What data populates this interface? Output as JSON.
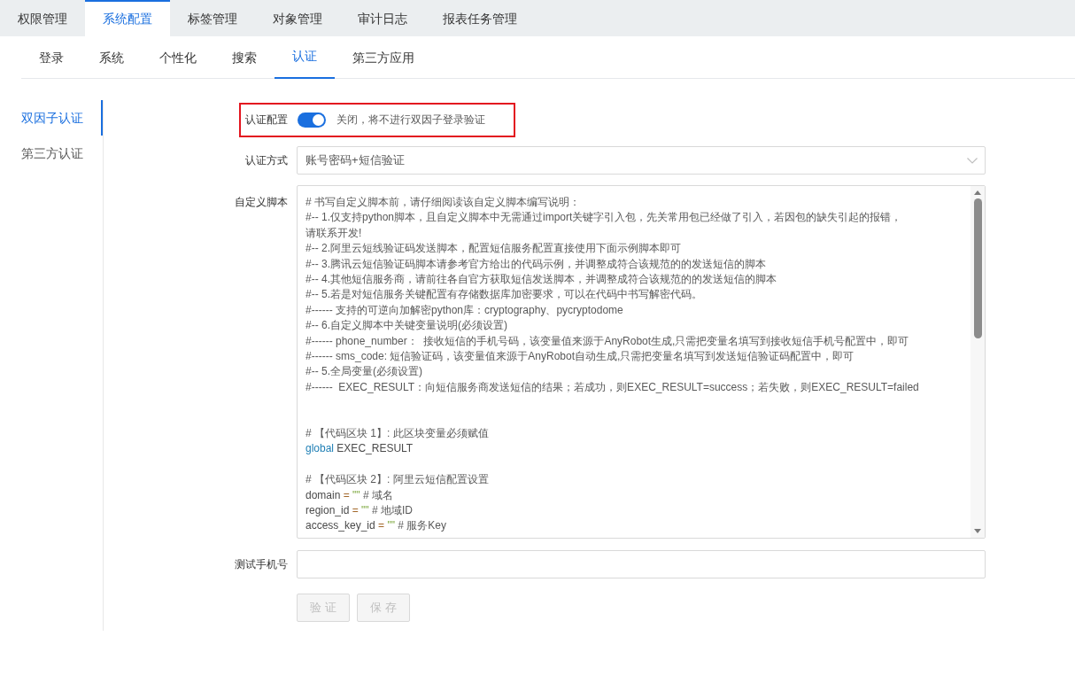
{
  "top_tabs": [
    {
      "label": "权限管理",
      "selected": false
    },
    {
      "label": "系统配置",
      "selected": true
    },
    {
      "label": "标签管理",
      "selected": false
    },
    {
      "label": "对象管理",
      "selected": false
    },
    {
      "label": "审计日志",
      "selected": false
    },
    {
      "label": "报表任务管理",
      "selected": false
    }
  ],
  "sub_tabs": [
    {
      "label": "登录",
      "selected": false
    },
    {
      "label": "系统",
      "selected": false
    },
    {
      "label": "个性化",
      "selected": false
    },
    {
      "label": "搜索",
      "selected": false
    },
    {
      "label": "认证",
      "selected": true
    },
    {
      "label": "第三方应用",
      "selected": false
    }
  ],
  "sidebar": {
    "items": [
      {
        "label": "双因子认证",
        "selected": true
      },
      {
        "label": "第三方认证",
        "selected": false
      }
    ]
  },
  "form": {
    "auth_config": {
      "label": "认证配置",
      "on": true,
      "description": "关闭，将不进行双因子登录验证",
      "highlighted": true
    },
    "auth_method": {
      "label": "认证方式",
      "value": "账号密码+短信验证"
    },
    "custom_script": {
      "label": "自定义脚本",
      "lines": [
        {
          "kind": "comment",
          "text": "# 书写自定义脚本前，请仔细阅读该自定义脚本编写说明："
        },
        {
          "kind": "comment",
          "text": "#-- 1.仅支持python脚本，且自定义脚本中无需通过import关键字引入包，先关常用包已经做了引入，若因包的缺失引起的报错，"
        },
        {
          "kind": "comment",
          "text": "请联系开发!"
        },
        {
          "kind": "comment",
          "text": "#-- 2.阿里云短线验证码发送脚本，配置短信服务配置直接使用下面示例脚本即可"
        },
        {
          "kind": "comment",
          "text": "#-- 3.腾讯云短信验证码脚本请参考官方给出的代码示例，并调整成符合该规范的的发送短信的脚本"
        },
        {
          "kind": "comment",
          "text": "#-- 4.其他短信服务商，请前往各自官方获取短信发送脚本，并调整成符合该规范的的发送短信的脚本"
        },
        {
          "kind": "comment",
          "text": "#-- 5.若是对短信服务关键配置有存储数据库加密要求，可以在代码中书写解密代码。"
        },
        {
          "kind": "comment",
          "text": "#------ 支持的可逆向加解密python库：cryptography、pycryptodome"
        },
        {
          "kind": "comment",
          "text": "#-- 6.自定义脚本中关键变量说明(必须设置)"
        },
        {
          "kind": "comment",
          "text": "#------ phone_number：  接收短信的手机号码，该变量值来源于AnyRobot生成,只需把变量名填写到接收短信手机号配置中，即可"
        },
        {
          "kind": "comment",
          "text": "#------ sms_code: 短信验证码，该变量值来源于AnyRobot自动生成,只需把变量名填写到发送短信验证码配置中，即可"
        },
        {
          "kind": "comment",
          "text": "#-- 5.全局变量(必须设置)"
        },
        {
          "kind": "comment",
          "text": "#------  EXEC_RESULT：向短信服务商发送短信的结果；若成功，则EXEC_RESULT=success；若失败，则EXEC_RESULT=failed"
        },
        {
          "kind": "blank"
        },
        {
          "kind": "blank"
        },
        {
          "kind": "comment",
          "text": "# 【代码区块 1】: 此区块变量必须赋值"
        },
        {
          "kind": "code",
          "tokens": [
            {
              "kind": "keyword",
              "text": "global"
            },
            {
              "kind": "plain",
              "text": " EXEC_RESULT"
            }
          ]
        },
        {
          "kind": "blank"
        },
        {
          "kind": "comment",
          "text": "# 【代码区块 2】: 阿里云短信配置设置"
        },
        {
          "kind": "code",
          "tokens": [
            {
              "kind": "plain",
              "text": "domain "
            },
            {
              "kind": "operator",
              "text": "="
            },
            {
              "kind": "string",
              "text": " \"\""
            },
            {
              "kind": "comment",
              "text": " # 域名"
            }
          ]
        },
        {
          "kind": "code",
          "tokens": [
            {
              "kind": "plain",
              "text": "region_id "
            },
            {
              "kind": "operator",
              "text": "="
            },
            {
              "kind": "string",
              "text": " \"\""
            },
            {
              "kind": "comment",
              "text": " # 地域ID"
            }
          ]
        },
        {
          "kind": "code",
          "tokens": [
            {
              "kind": "plain",
              "text": "access_key_id "
            },
            {
              "kind": "operator",
              "text": "="
            },
            {
              "kind": "string",
              "text": " \"\""
            },
            {
              "kind": "comment",
              "text": " # 服务Key"
            }
          ]
        }
      ]
    },
    "test_phone": {
      "label": "测试手机号"
    },
    "buttons": [
      {
        "label": "验 证",
        "disabled": true
      },
      {
        "label": "保 存",
        "disabled": true
      }
    ]
  }
}
